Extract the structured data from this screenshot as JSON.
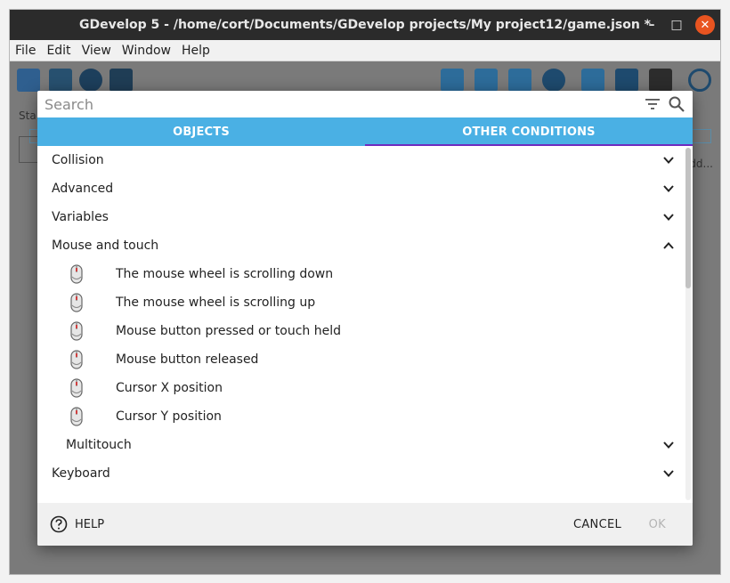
{
  "window": {
    "title": "GDevelop 5 - /home/cort/Documents/GDevelop projects/My project12/game.json *",
    "controls": {
      "minimize": "–",
      "maximize": "□",
      "close": "✕"
    }
  },
  "menubar": {
    "items": [
      {
        "label": "File"
      },
      {
        "label": "Edit"
      },
      {
        "label": "View"
      },
      {
        "label": "Window"
      },
      {
        "label": "Help"
      }
    ]
  },
  "background": {
    "stage_label": "Sta",
    "ghost_text": "dd..."
  },
  "dialog": {
    "search": {
      "placeholder": "Search",
      "value": ""
    },
    "tabs": [
      {
        "label": "OBJECTS",
        "active": false
      },
      {
        "label": "OTHER CONDITIONS",
        "active": true
      }
    ],
    "groups": [
      {
        "label": "Collision"
      },
      {
        "label": "Advanced"
      },
      {
        "label": "Variables"
      },
      {
        "label": "Mouse and touch"
      }
    ],
    "mouse_items": [
      {
        "label": "The mouse wheel is scrolling down"
      },
      {
        "label": "The mouse wheel is scrolling up"
      },
      {
        "label": "Mouse button pressed or touch held"
      },
      {
        "label": "Mouse button released"
      },
      {
        "label": "Cursor X position"
      },
      {
        "label": "Cursor Y position"
      }
    ],
    "subgroup": {
      "label": "Multitouch"
    },
    "after_group": {
      "label": "Keyboard"
    },
    "footer": {
      "help_label": "HELP",
      "cancel_label": "CANCEL",
      "ok_label": "OK"
    }
  },
  "colors": {
    "tab_bar": "#4ab0e4",
    "active_tab_indicator": "#6f2bbf",
    "close_button": "#e95420",
    "titlebar": "#2b2b2b"
  }
}
